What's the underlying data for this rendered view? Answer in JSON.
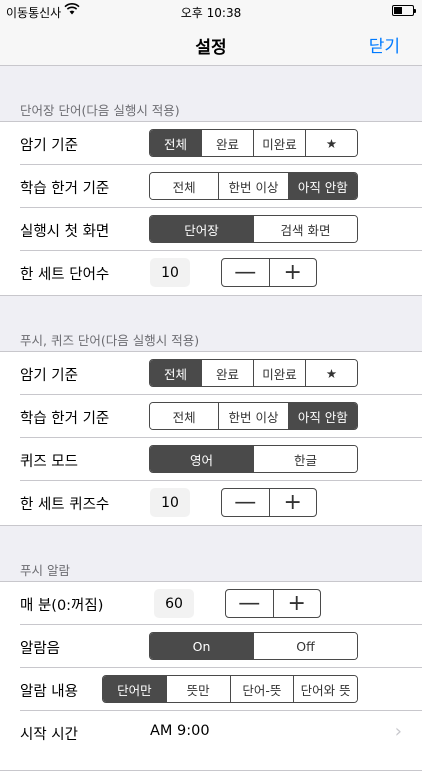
{
  "status_bar": {
    "carrier": "이동통신사",
    "wifi_icon": "wifi-icon",
    "time": "오후 10:38",
    "battery_level": 0.45
  },
  "nav": {
    "title": "설정",
    "close_label": "닫기"
  },
  "word_section": {
    "header": "단어장 단어(다음 실행시 적용)",
    "memorize": {
      "label": "암기 기준",
      "options": [
        "전체",
        "완료",
        "미완료",
        "★"
      ],
      "selected": 0
    },
    "study_limit": {
      "label": "학습 한거 기준",
      "options": [
        "전체",
        "한번 이상",
        "아직 안함"
      ],
      "selected": 2
    },
    "start_screen": {
      "label": "실행시 첫 화면",
      "options": [
        "단어장",
        "검색 화면"
      ],
      "selected": 0
    },
    "set_count": {
      "label": "한 세트 단어수",
      "value": "10",
      "minus": "—",
      "plus": "+"
    }
  },
  "quiz_section": {
    "header": "푸시, 퀴즈 단어(다음 실행시 적용)",
    "memorize": {
      "label": "암기 기준",
      "options": [
        "전체",
        "완료",
        "미완료",
        "★"
      ],
      "selected": 0
    },
    "study_limit": {
      "label": "학습 한거 기준",
      "options": [
        "전체",
        "한번 이상",
        "아직 안함"
      ],
      "selected": 2
    },
    "quiz_mode": {
      "label": "퀴즈 모드",
      "options": [
        "영어",
        "한글"
      ],
      "selected": 0
    },
    "set_count": {
      "label": "한 세트 퀴즈수",
      "value": "10",
      "minus": "—",
      "plus": "+"
    }
  },
  "push_section": {
    "header": "푸시 알람",
    "interval": {
      "label": "매 분(0:꺼짐)",
      "value": "60",
      "minus": "—",
      "plus": "+"
    },
    "sound": {
      "label": "알람음",
      "options": [
        "On",
        "Off"
      ],
      "selected": 0
    },
    "content": {
      "label": "알람 내용",
      "options": [
        "단어만",
        "뜻만",
        "단어-뜻",
        "단어와 뜻"
      ],
      "selected": 0
    },
    "start_time": {
      "label": "시작 시간",
      "value": "AM 9:00",
      "chevron": "›"
    }
  }
}
